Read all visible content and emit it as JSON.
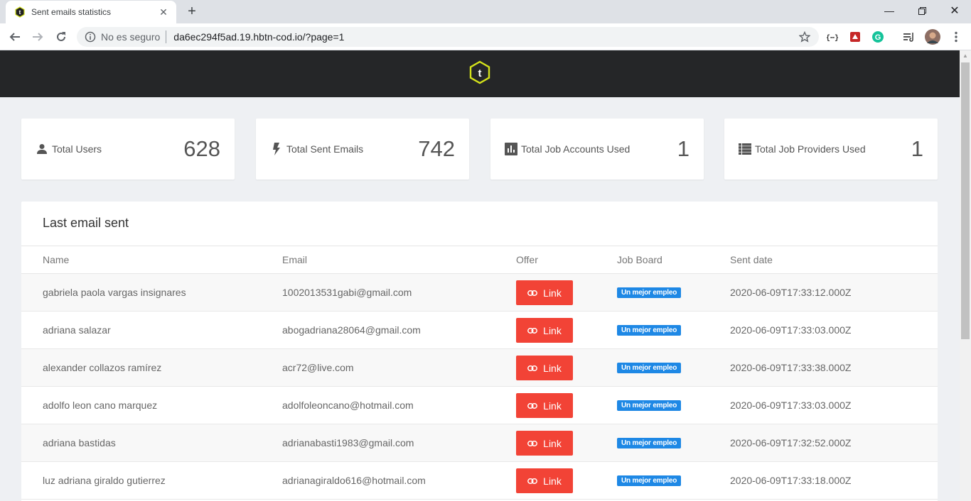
{
  "browser": {
    "tab_title": "Sent emails statistics",
    "security_label": "No es seguro",
    "url": "da6ec294f5ad.19.hbtn-cod.io/?page=1"
  },
  "stats": [
    {
      "icon": "user-icon",
      "label": "Total Users",
      "value": "628"
    },
    {
      "icon": "lightning-icon",
      "label": "Total Sent Emails",
      "value": "742"
    },
    {
      "icon": "bar-chart-icon",
      "label": "Total Job Accounts Used",
      "value": "1"
    },
    {
      "icon": "list-icon",
      "label": "Total Job Providers Used",
      "value": "1"
    }
  ],
  "table": {
    "title": "Last email sent",
    "columns": [
      "Name",
      "Email",
      "Offer",
      "Job Board",
      "Sent date"
    ],
    "link_label": "Link",
    "rows": [
      {
        "name": "gabriela paola vargas insignares",
        "email": "1002013531gabi@gmail.com",
        "job_board": "Un mejor empleo",
        "date": "2020-06-09T17:33:12.000Z"
      },
      {
        "name": "adriana salazar",
        "email": "abogadriana28064@gmail.com",
        "job_board": "Un mejor empleo",
        "date": "2020-06-09T17:33:03.000Z"
      },
      {
        "name": "alexander collazos ramírez",
        "email": "acr72@live.com",
        "job_board": "Un mejor empleo",
        "date": "2020-06-09T17:33:38.000Z"
      },
      {
        "name": "adolfo leon cano marquez",
        "email": "adolfoleoncano@hotmail.com",
        "job_board": "Un mejor empleo",
        "date": "2020-06-09T17:33:03.000Z"
      },
      {
        "name": "adriana bastidas",
        "email": "adrianabasti1983@gmail.com",
        "job_board": "Un mejor empleo",
        "date": "2020-06-09T17:32:52.000Z"
      },
      {
        "name": "luz adriana giraldo gutierrez",
        "email": "adrianagiraldo616@hotmail.com",
        "job_board": "Un mejor empleo",
        "date": "2020-06-09T17:33:18.000Z"
      }
    ]
  },
  "colors": {
    "header_bg": "#252628",
    "logo": "#d4e21b",
    "link_button": "#f24336",
    "badge": "#1e88e5"
  }
}
